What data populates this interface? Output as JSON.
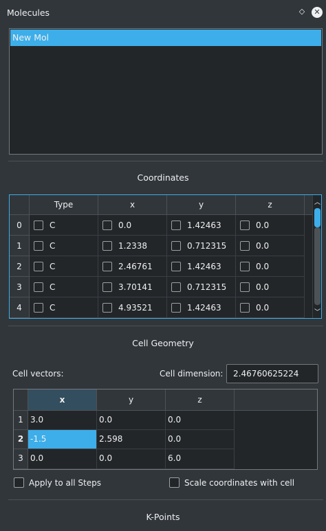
{
  "dock": {
    "title": "Molecules",
    "float_icon": "◇",
    "close_icon": "✕"
  },
  "molecules": {
    "items": [
      "New Mol"
    ],
    "selected_index": 0
  },
  "coordinates": {
    "title": "Coordinates",
    "headers": [
      "Type",
      "x",
      "y",
      "z"
    ],
    "rows": [
      {
        "index": "0",
        "type": "C",
        "x": "0.0",
        "y": "1.42463",
        "z": "0.0"
      },
      {
        "index": "1",
        "type": "C",
        "x": "1.2338",
        "y": "0.712315",
        "z": "0.0"
      },
      {
        "index": "2",
        "type": "C",
        "x": "2.46761",
        "y": "1.42463",
        "z": "0.0"
      },
      {
        "index": "3",
        "type": "C",
        "x": "3.70141",
        "y": "0.712315",
        "z": "0.0"
      },
      {
        "index": "4",
        "type": "C",
        "x": "4.93521",
        "y": "1.42463",
        "z": "0.0"
      }
    ],
    "scroll_up_icon": "︿",
    "scroll_down_icon": "﹀"
  },
  "cell_geometry": {
    "title": "Cell Geometry",
    "cell_vectors_label": "Cell vectors:",
    "cell_dimension_label": "Cell dimension:",
    "cell_dimension_value": "2.46760625224",
    "headers": [
      "x",
      "y",
      "z"
    ],
    "rows": [
      {
        "index": "1",
        "x": "3.0",
        "y": "0.0",
        "z": "0.0"
      },
      {
        "index": "2",
        "x": "-1.5",
        "y": "2.598",
        "z": "0.0"
      },
      {
        "index": "3",
        "x": "0.0",
        "y": "0.0",
        "z": "6.0"
      }
    ],
    "selected_cell": "2.x",
    "apply_all_label": "Apply to all Steps",
    "scale_coords_label": "Scale coordinates with cell"
  },
  "kpoints": {
    "title": "K-Points"
  },
  "colors": {
    "accent": "#3daee9",
    "background": "#31363b",
    "field": "#232629"
  }
}
